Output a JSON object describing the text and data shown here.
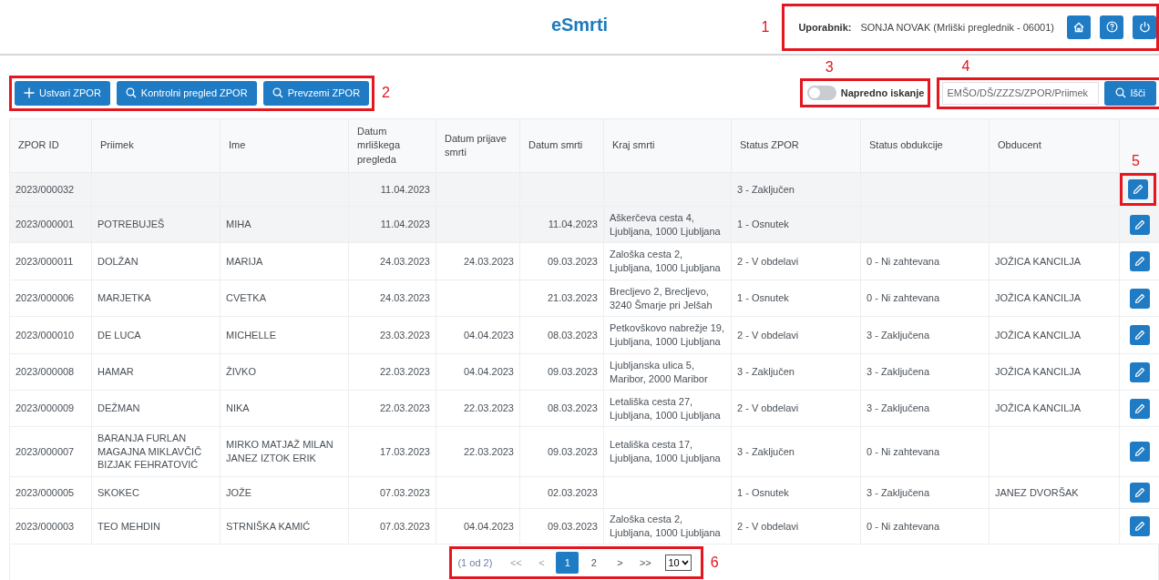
{
  "header": {
    "title": "eSmrti",
    "user_label": "Uporabnik:",
    "user_name": "SONJA NOVAK (Mrliški preglednik - 06001)",
    "callout": "1"
  },
  "toolbar": {
    "callout": "2",
    "buttons": [
      {
        "label": "Ustvari ZPOR",
        "kind": "add"
      },
      {
        "label": "Kontrolni pregled ZPOR",
        "kind": "search"
      },
      {
        "label": "Prevzemi ZPOR",
        "kind": "search"
      }
    ]
  },
  "advanced_search": {
    "label": "Napredno iskanje",
    "on": false,
    "callout": "3"
  },
  "search": {
    "placeholder": "EMŠO/DŠ/ZZZS/ZPOR/Priimek",
    "button": "Išči",
    "callout": "4"
  },
  "table": {
    "columns": [
      "ZPOR ID",
      "Priimek",
      "Ime",
      "Datum mrliškega pregleda",
      "Datum prijave smrti",
      "Datum smrti",
      "Kraj smrti",
      "Status ZPOR",
      "Status obdukcije",
      "Obducent"
    ],
    "rows": [
      {
        "cells": [
          "2023/000032",
          "",
          "",
          "11.04.2023",
          "",
          "",
          "",
          "3 - Zaključen",
          "",
          ""
        ],
        "highlighted": true,
        "callout": "5"
      },
      {
        "cells": [
          "2023/000001",
          "POTREBUJEŠ",
          "MIHA",
          "11.04.2023",
          "",
          "11.04.2023",
          "Aškerčeva cesta 4, Ljubljana, 1000 Ljubljana",
          "1 - Osnutek",
          "",
          ""
        ],
        "highlighted": true
      },
      {
        "cells": [
          "2023/000011",
          "DOLŽAN",
          "MARIJA",
          "24.03.2023",
          "24.03.2023",
          "09.03.2023",
          "Zaloška cesta 2, Ljubljana, 1000 Ljubljana",
          "2 - V obdelavi",
          "0 - Ni zahtevana",
          "JOŽICA KANCILJA"
        ],
        "highlighted": false
      },
      {
        "cells": [
          "2023/000006",
          "MARJETKA",
          "CVETKA",
          "24.03.2023",
          "",
          "21.03.2023",
          "Brecljevo 2, Brecljevo, 3240 Šmarje pri Jelšah",
          "1 - Osnutek",
          "0 - Ni zahtevana",
          "JOŽICA KANCILJA"
        ],
        "highlighted": false
      },
      {
        "cells": [
          "2023/000010",
          "DE LUCA",
          "MICHELLE",
          "23.03.2023",
          "04.04.2023",
          "08.03.2023",
          "Petkovškovo nabrežje 19, Ljubljana, 1000 Ljubljana",
          "2 - V obdelavi",
          "3 - Zaključena",
          "JOŽICA KANCILJA"
        ],
        "highlighted": false
      },
      {
        "cells": [
          "2023/000008",
          "HAMAR",
          "ŽIVKO",
          "22.03.2023",
          "04.04.2023",
          "09.03.2023",
          "Ljubljanska ulica 5, Maribor, 2000 Maribor",
          "3 - Zaključen",
          "3 - Zaključena",
          "JOŽICA KANCILJA"
        ],
        "highlighted": false
      },
      {
        "cells": [
          "2023/000009",
          "DEŽMAN",
          "NIKA",
          "22.03.2023",
          "22.03.2023",
          "08.03.2023",
          "Letališka cesta 27, Ljubljana, 1000 Ljubljana",
          "2 - V obdelavi",
          "3 - Zaključena",
          "JOŽICA KANCILJA"
        ],
        "highlighted": false
      },
      {
        "cells": [
          "2023/000007",
          "BARANJA FURLAN MAGAJNA MIKLAVČIČ BIZJAK FEHRATOVIĆ",
          "MIRKO MATJAŽ MILAN JANEZ IZTOK ERIK",
          "17.03.2023",
          "22.03.2023",
          "09.03.2023",
          "Letališka cesta 17, Ljubljana, 1000 Ljubljana",
          "3 - Zaključen",
          "0 - Ni zahtevana",
          ""
        ],
        "highlighted": false
      },
      {
        "cells": [
          "2023/000005",
          "SKOKEC",
          "JOŽE",
          "07.03.2023",
          "",
          "02.03.2023",
          "",
          "1 - Osnutek",
          "3 - Zaključena",
          "JANEZ DVORŠAK"
        ],
        "highlighted": false
      },
      {
        "cells": [
          "2023/000003",
          "TEO MEHDIN",
          "STRNIŠKA KAMIĆ",
          "07.03.2023",
          "04.04.2023",
          "09.03.2023",
          "Zaloška cesta 2, Ljubljana, 1000 Ljubljana",
          "2 - V obdelavi",
          "0 - Ni zahtevana",
          ""
        ],
        "highlighted": false
      }
    ]
  },
  "pager": {
    "callout": "6",
    "summary": "(1 od 2)",
    "first": "<<",
    "prev": "<",
    "pages": [
      {
        "label": "1",
        "selected": true
      },
      {
        "label": "2",
        "selected": false
      }
    ],
    "next": ">",
    "last": ">>",
    "page_size": "10"
  }
}
